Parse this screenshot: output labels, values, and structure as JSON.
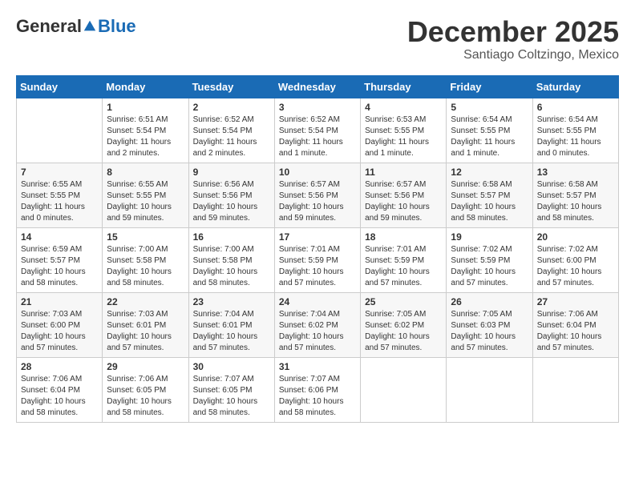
{
  "header": {
    "logo_general": "General",
    "logo_blue": "Blue",
    "month_title": "December 2025",
    "subtitle": "Santiago Coltzingo, Mexico"
  },
  "weekdays": [
    "Sunday",
    "Monday",
    "Tuesday",
    "Wednesday",
    "Thursday",
    "Friday",
    "Saturday"
  ],
  "weeks": [
    [
      {
        "day": "",
        "info": ""
      },
      {
        "day": "1",
        "info": "Sunrise: 6:51 AM\nSunset: 5:54 PM\nDaylight: 11 hours\nand 2 minutes."
      },
      {
        "day": "2",
        "info": "Sunrise: 6:52 AM\nSunset: 5:54 PM\nDaylight: 11 hours\nand 2 minutes."
      },
      {
        "day": "3",
        "info": "Sunrise: 6:52 AM\nSunset: 5:54 PM\nDaylight: 11 hours\nand 1 minute."
      },
      {
        "day": "4",
        "info": "Sunrise: 6:53 AM\nSunset: 5:55 PM\nDaylight: 11 hours\nand 1 minute."
      },
      {
        "day": "5",
        "info": "Sunrise: 6:54 AM\nSunset: 5:55 PM\nDaylight: 11 hours\nand 1 minute."
      },
      {
        "day": "6",
        "info": "Sunrise: 6:54 AM\nSunset: 5:55 PM\nDaylight: 11 hours\nand 0 minutes."
      }
    ],
    [
      {
        "day": "7",
        "info": "Sunrise: 6:55 AM\nSunset: 5:55 PM\nDaylight: 11 hours\nand 0 minutes."
      },
      {
        "day": "8",
        "info": "Sunrise: 6:55 AM\nSunset: 5:55 PM\nDaylight: 10 hours\nand 59 minutes."
      },
      {
        "day": "9",
        "info": "Sunrise: 6:56 AM\nSunset: 5:56 PM\nDaylight: 10 hours\nand 59 minutes."
      },
      {
        "day": "10",
        "info": "Sunrise: 6:57 AM\nSunset: 5:56 PM\nDaylight: 10 hours\nand 59 minutes."
      },
      {
        "day": "11",
        "info": "Sunrise: 6:57 AM\nSunset: 5:56 PM\nDaylight: 10 hours\nand 59 minutes."
      },
      {
        "day": "12",
        "info": "Sunrise: 6:58 AM\nSunset: 5:57 PM\nDaylight: 10 hours\nand 58 minutes."
      },
      {
        "day": "13",
        "info": "Sunrise: 6:58 AM\nSunset: 5:57 PM\nDaylight: 10 hours\nand 58 minutes."
      }
    ],
    [
      {
        "day": "14",
        "info": "Sunrise: 6:59 AM\nSunset: 5:57 PM\nDaylight: 10 hours\nand 58 minutes."
      },
      {
        "day": "15",
        "info": "Sunrise: 7:00 AM\nSunset: 5:58 PM\nDaylight: 10 hours\nand 58 minutes."
      },
      {
        "day": "16",
        "info": "Sunrise: 7:00 AM\nSunset: 5:58 PM\nDaylight: 10 hours\nand 58 minutes."
      },
      {
        "day": "17",
        "info": "Sunrise: 7:01 AM\nSunset: 5:59 PM\nDaylight: 10 hours\nand 57 minutes."
      },
      {
        "day": "18",
        "info": "Sunrise: 7:01 AM\nSunset: 5:59 PM\nDaylight: 10 hours\nand 57 minutes."
      },
      {
        "day": "19",
        "info": "Sunrise: 7:02 AM\nSunset: 5:59 PM\nDaylight: 10 hours\nand 57 minutes."
      },
      {
        "day": "20",
        "info": "Sunrise: 7:02 AM\nSunset: 6:00 PM\nDaylight: 10 hours\nand 57 minutes."
      }
    ],
    [
      {
        "day": "21",
        "info": "Sunrise: 7:03 AM\nSunset: 6:00 PM\nDaylight: 10 hours\nand 57 minutes."
      },
      {
        "day": "22",
        "info": "Sunrise: 7:03 AM\nSunset: 6:01 PM\nDaylight: 10 hours\nand 57 minutes."
      },
      {
        "day": "23",
        "info": "Sunrise: 7:04 AM\nSunset: 6:01 PM\nDaylight: 10 hours\nand 57 minutes."
      },
      {
        "day": "24",
        "info": "Sunrise: 7:04 AM\nSunset: 6:02 PM\nDaylight: 10 hours\nand 57 minutes."
      },
      {
        "day": "25",
        "info": "Sunrise: 7:05 AM\nSunset: 6:02 PM\nDaylight: 10 hours\nand 57 minutes."
      },
      {
        "day": "26",
        "info": "Sunrise: 7:05 AM\nSunset: 6:03 PM\nDaylight: 10 hours\nand 57 minutes."
      },
      {
        "day": "27",
        "info": "Sunrise: 7:06 AM\nSunset: 6:04 PM\nDaylight: 10 hours\nand 57 minutes."
      }
    ],
    [
      {
        "day": "28",
        "info": "Sunrise: 7:06 AM\nSunset: 6:04 PM\nDaylight: 10 hours\nand 58 minutes."
      },
      {
        "day": "29",
        "info": "Sunrise: 7:06 AM\nSunset: 6:05 PM\nDaylight: 10 hours\nand 58 minutes."
      },
      {
        "day": "30",
        "info": "Sunrise: 7:07 AM\nSunset: 6:05 PM\nDaylight: 10 hours\nand 58 minutes."
      },
      {
        "day": "31",
        "info": "Sunrise: 7:07 AM\nSunset: 6:06 PM\nDaylight: 10 hours\nand 58 minutes."
      },
      {
        "day": "",
        "info": ""
      },
      {
        "day": "",
        "info": ""
      },
      {
        "day": "",
        "info": ""
      }
    ]
  ]
}
